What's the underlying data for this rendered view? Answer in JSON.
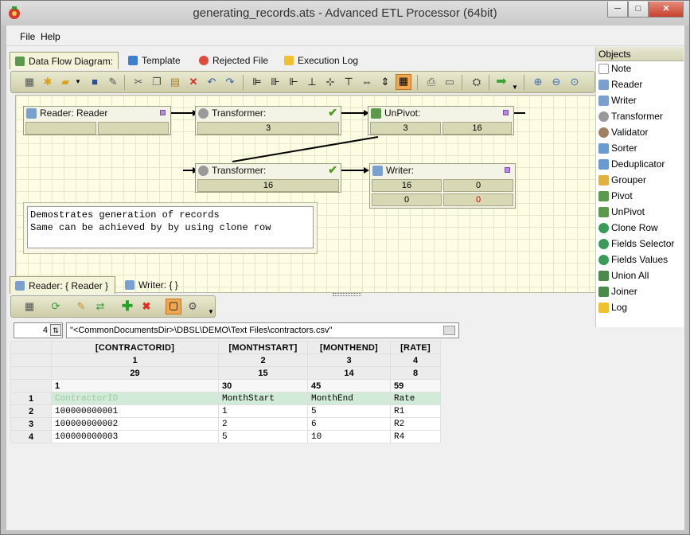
{
  "window": {
    "title": "generating_records.ats - Advanced ETL Processor (64bit)",
    "controls": {
      "minimize": "─",
      "maximize": "□",
      "close": "✕"
    }
  },
  "menu": [
    {
      "label": "File",
      "key": "F"
    },
    {
      "label": "Help",
      "key": "H"
    }
  ],
  "top_tabs": [
    {
      "label": "Data Flow Diagram:",
      "active": true
    },
    {
      "label": "Template",
      "active": false
    },
    {
      "label": "Rejected File",
      "active": false
    },
    {
      "label": "Execution Log",
      "active": false
    }
  ],
  "diagram": {
    "nodes": {
      "reader": {
        "title": "Reader: Reader",
        "cells": [
          "",
          ""
        ]
      },
      "transformer1": {
        "title": "Transformer:",
        "cells": [
          "3"
        ]
      },
      "unpivot": {
        "title": "UnPivot:",
        "cells": [
          "3",
          "16"
        ]
      },
      "transformer2": {
        "title": "Transformer:",
        "cells": [
          "16"
        ]
      },
      "writer": {
        "title": "Writer:",
        "cells": [
          "16",
          "0",
          "0",
          "0"
        ]
      }
    },
    "note": "Demostrates generation of records\nSame can be achieved by by using clone row"
  },
  "objects": {
    "title": "Objects",
    "items": [
      "Note",
      "Reader",
      "Writer",
      "Transformer",
      "Validator",
      "Sorter",
      "Deduplicator",
      "Grouper",
      "Pivot",
      "UnPivot",
      "Clone Row",
      "Fields Selector",
      "Fields Values",
      "Union All",
      "Joiner",
      "Log"
    ]
  },
  "bottom_tabs": [
    {
      "label": "Reader: { Reader }",
      "active": true
    },
    {
      "label": "Writer: { }",
      "active": false
    }
  ],
  "reader_panel": {
    "skip_value": "4",
    "file_path": "\"<CommonDocumentsDir>\\DBSL\\DEMO\\Text Files\\contractors.csv\"",
    "columns": [
      "[CONTRACTORID]",
      "[MONTHSTART]",
      "[MONTHEND]",
      "[RATE]"
    ],
    "field_numbers": [
      "1",
      "2",
      "3",
      "4"
    ],
    "widths": [
      "29",
      "15",
      "14",
      "8"
    ],
    "offsets": [
      "1",
      "30",
      "45",
      "59"
    ],
    "rows": [
      {
        "n": "1",
        "cells": [
          "ContractorID",
          "MonthStart",
          "MonthEnd",
          "Rate"
        ]
      },
      {
        "n": "2",
        "cells": [
          "100000000001",
          "1",
          "5",
          "R1"
        ]
      },
      {
        "n": "3",
        "cells": [
          "100000000002",
          "2",
          "6",
          "R2"
        ]
      },
      {
        "n": "4",
        "cells": [
          "100000000003",
          "5",
          "10",
          "R4"
        ]
      }
    ]
  },
  "colors": {
    "canvas": "#fdfde4",
    "node_cell": "#d8d8b4",
    "toolbar": "#dcdcbc",
    "error_value": "#e00000",
    "check": "#4a9c1a"
  }
}
